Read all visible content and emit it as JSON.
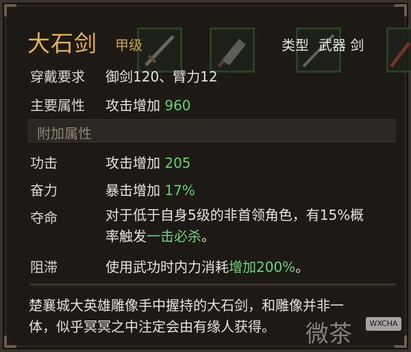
{
  "item": {
    "name": "大石剑",
    "grade": "甲级",
    "type_label": "类型",
    "type_value": "武器 剑"
  },
  "requirements": {
    "label": "穿戴要求",
    "value": "御剑120、臂力12"
  },
  "main_attr": {
    "label": "主要属性",
    "text": "攻击增加",
    "value": "960"
  },
  "section_title": "附加属性",
  "extra_attrs": [
    {
      "label": "功击",
      "text": "攻击增加",
      "value": "205"
    },
    {
      "label": "奋力",
      "text": "暴击增加",
      "value": "17%"
    },
    {
      "label": "夺命",
      "text_line1": "对于低于自身5级的非首领角色，有15%概",
      "text_line2_prefix": "率触发",
      "text_line2_highlight": "一击必杀",
      "text_line2_suffix": "。"
    },
    {
      "label": "阻滞",
      "text_prefix": "使用武功时内力消耗",
      "text_highlight": "增加200%",
      "text_suffix": "。"
    }
  ],
  "description": {
    "line1": "楚襄城大英雄雕像手中握持的大石剑，和雕像并非一",
    "line2": "体，似乎冥冥之中注定会由有缘人获得。"
  },
  "watermark": {
    "text": "微茶",
    "badge": "WXCHA"
  },
  "colors": {
    "name": "#e3b24d",
    "grade": "#cfa443",
    "positive": "#63d06b",
    "panel": "#1d1a16"
  }
}
